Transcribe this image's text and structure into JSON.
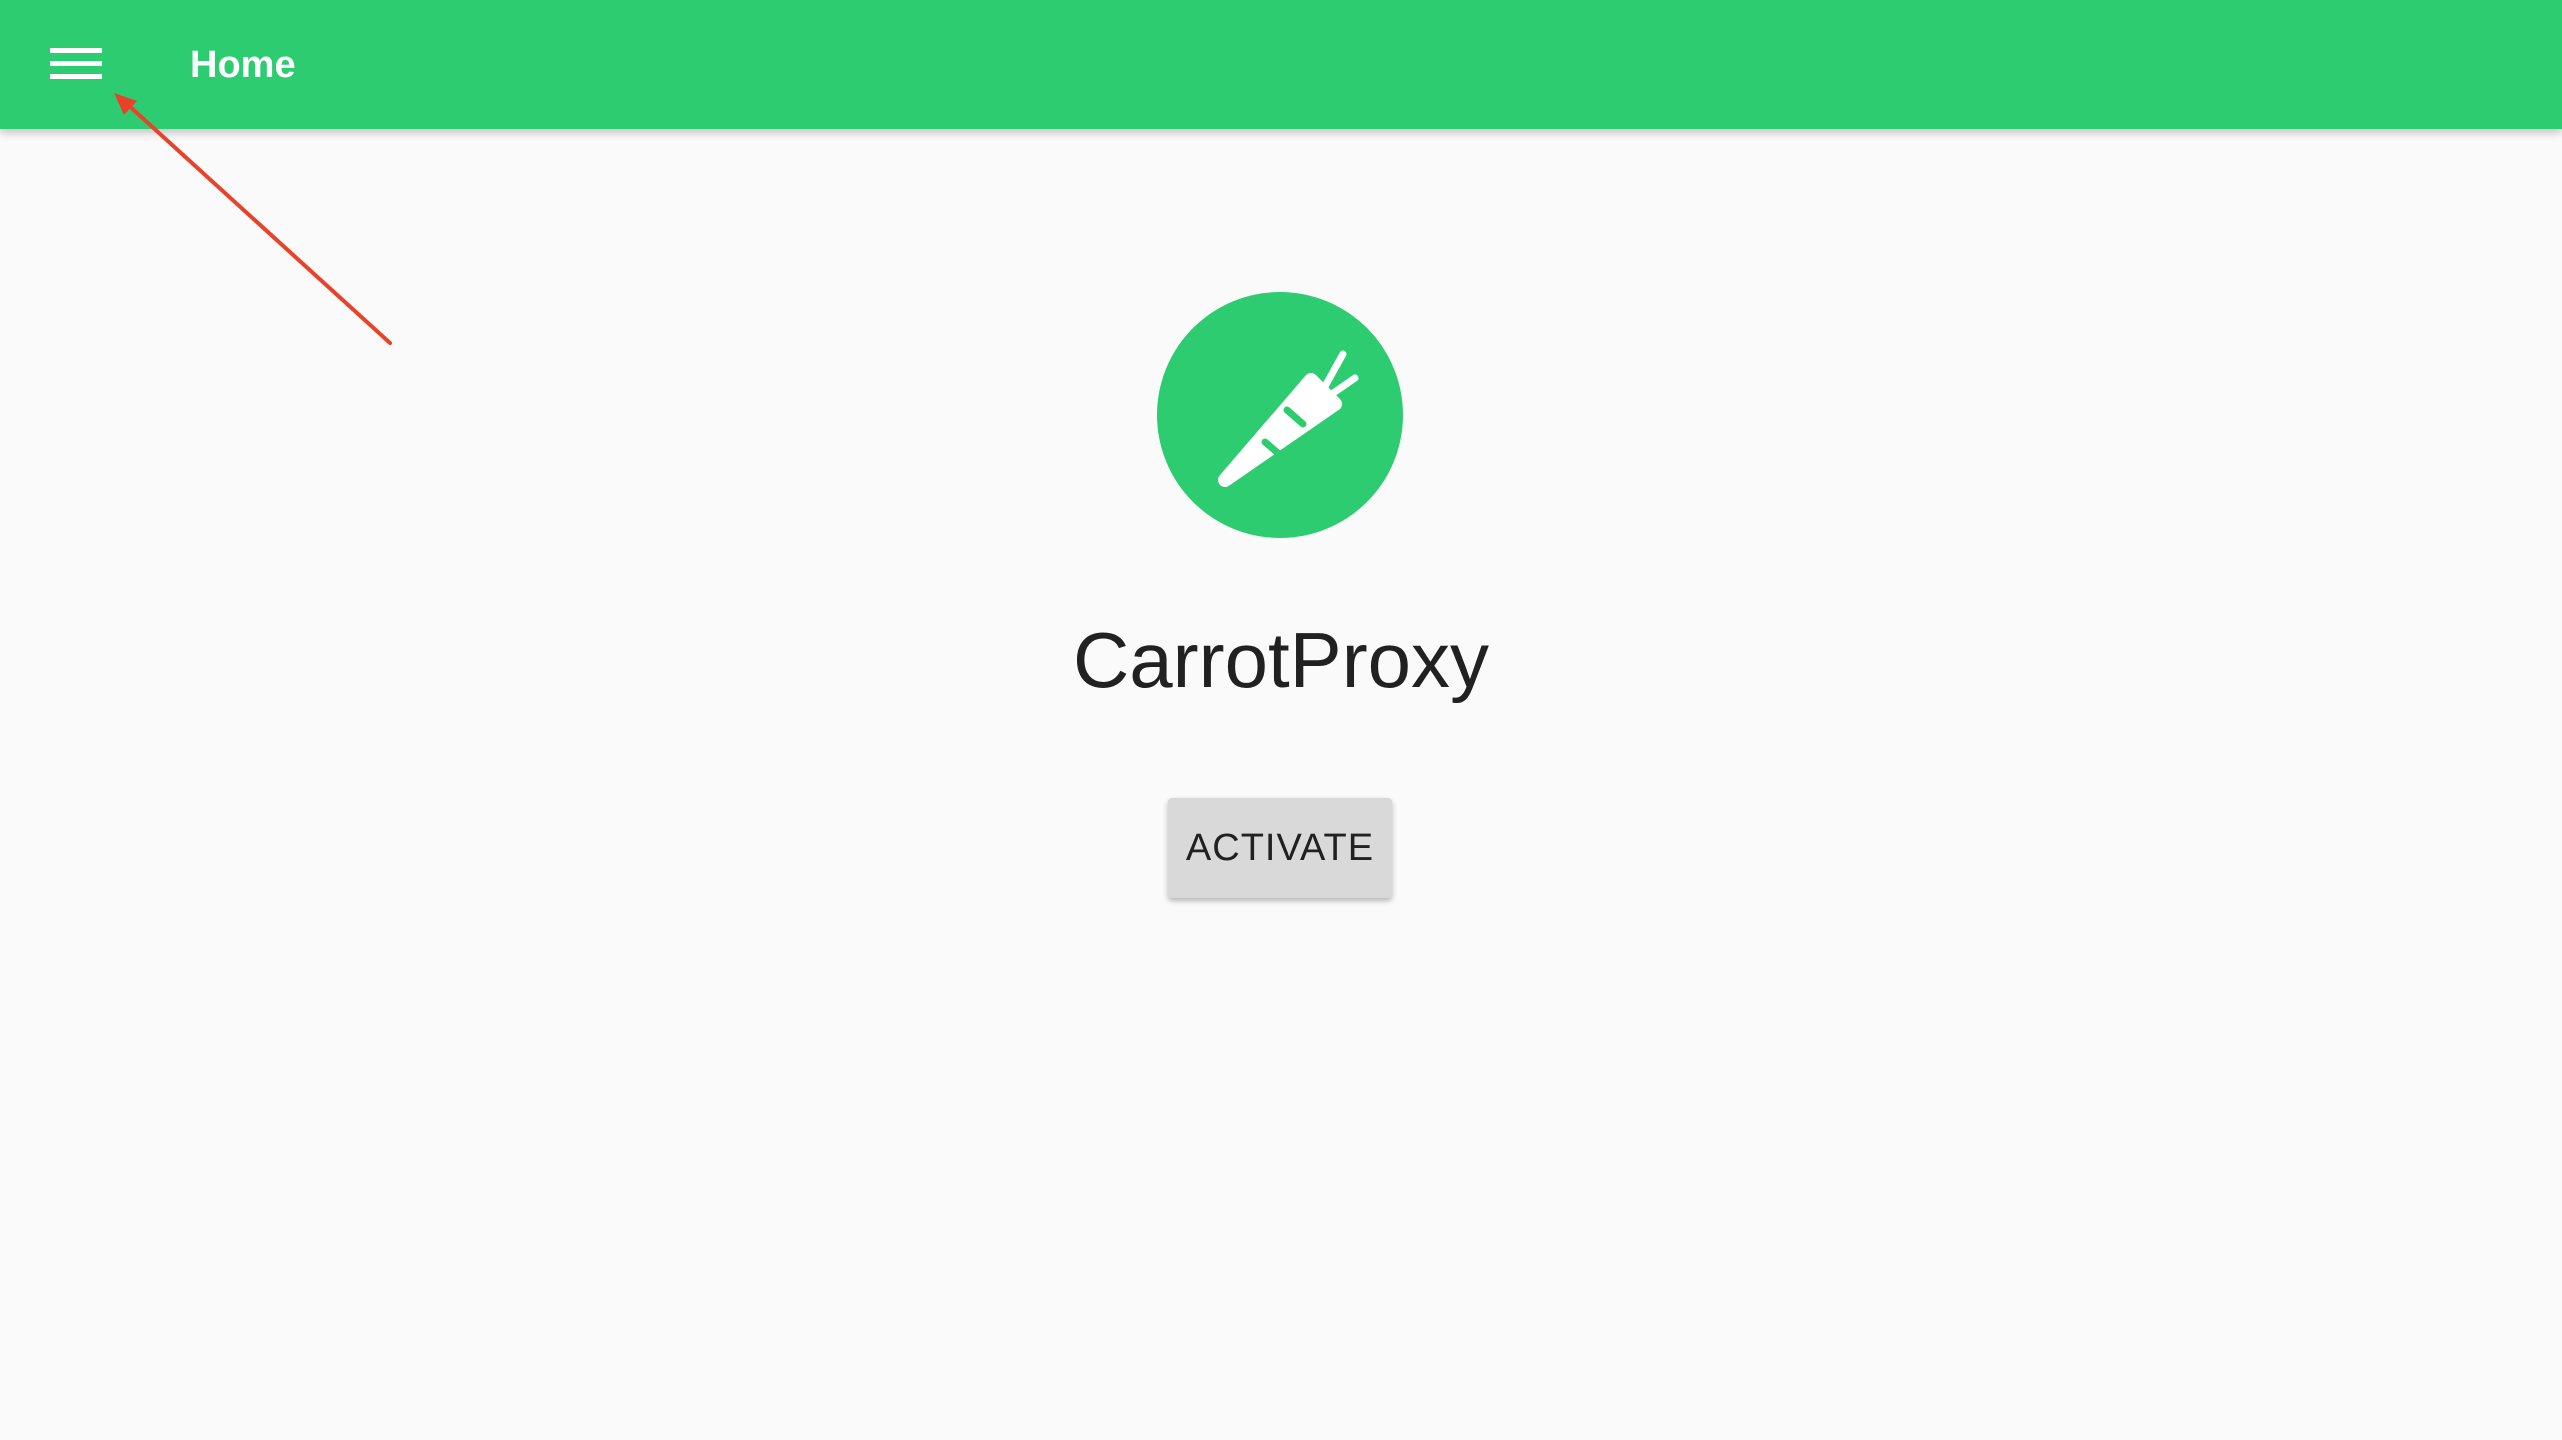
{
  "app_bar": {
    "title": "Home",
    "menu_icon": "hamburger-menu-icon",
    "color": "#2ecc71"
  },
  "main": {
    "logo_icon": "carrot-icon",
    "product_name": "CarrotProxy",
    "activate_label": "ACTIVATE"
  },
  "annotation": {
    "color": "#e8432a",
    "target": "menu-button"
  }
}
